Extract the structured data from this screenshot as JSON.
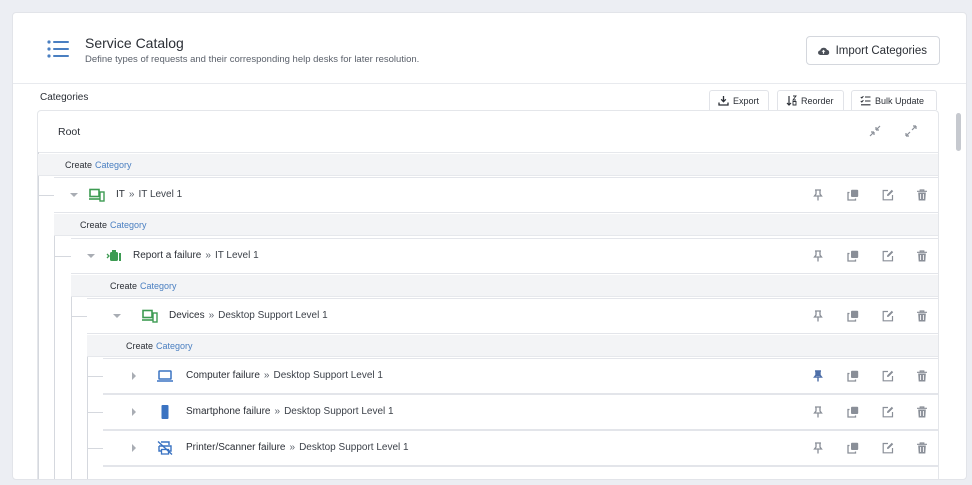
{
  "header": {
    "title": "Service Catalog",
    "subtitle": "Define types of requests and their corresponding help desks for later resolution.",
    "import_label": "Import Categories",
    "icon": "list-icon"
  },
  "categories_bar": {
    "label": "Categories",
    "tabs": [
      {
        "label": "Export",
        "icon": "download-icon"
      },
      {
        "label": "Reorder",
        "icon": "sort-icon"
      },
      {
        "label": "Bulk Update",
        "icon": "checklist-icon"
      }
    ]
  },
  "tree": {
    "root_label": "Root",
    "create_prefix": "Create",
    "create_link": "Category",
    "separator": "»",
    "nodes": [
      {
        "name": "IT",
        "level": "IT Level 1",
        "icon": "devices-icon",
        "expanded": true
      },
      {
        "name": "Report a failure",
        "level": "IT Level 1",
        "icon": "failure-icon",
        "expanded": true
      },
      {
        "name": "Devices",
        "level": "Desktop Support Level 1",
        "icon": "devices-icon",
        "expanded": true
      },
      {
        "name": "Computer failure",
        "level": "Desktop Support Level 1",
        "icon": "laptop-icon",
        "expanded": false,
        "pinned": true
      },
      {
        "name": "Smartphone failure",
        "level": "Desktop Support Level 1",
        "icon": "smartphone-icon",
        "expanded": false
      },
      {
        "name": "Printer/Scanner failure",
        "level": "Desktop Support Level 1",
        "icon": "printer-off-icon",
        "expanded": false
      }
    ]
  },
  "colors": {
    "accent": "#4a7fc1",
    "icon_gray": "#8a8f98",
    "pinned_blue": "#4e6fa8"
  }
}
